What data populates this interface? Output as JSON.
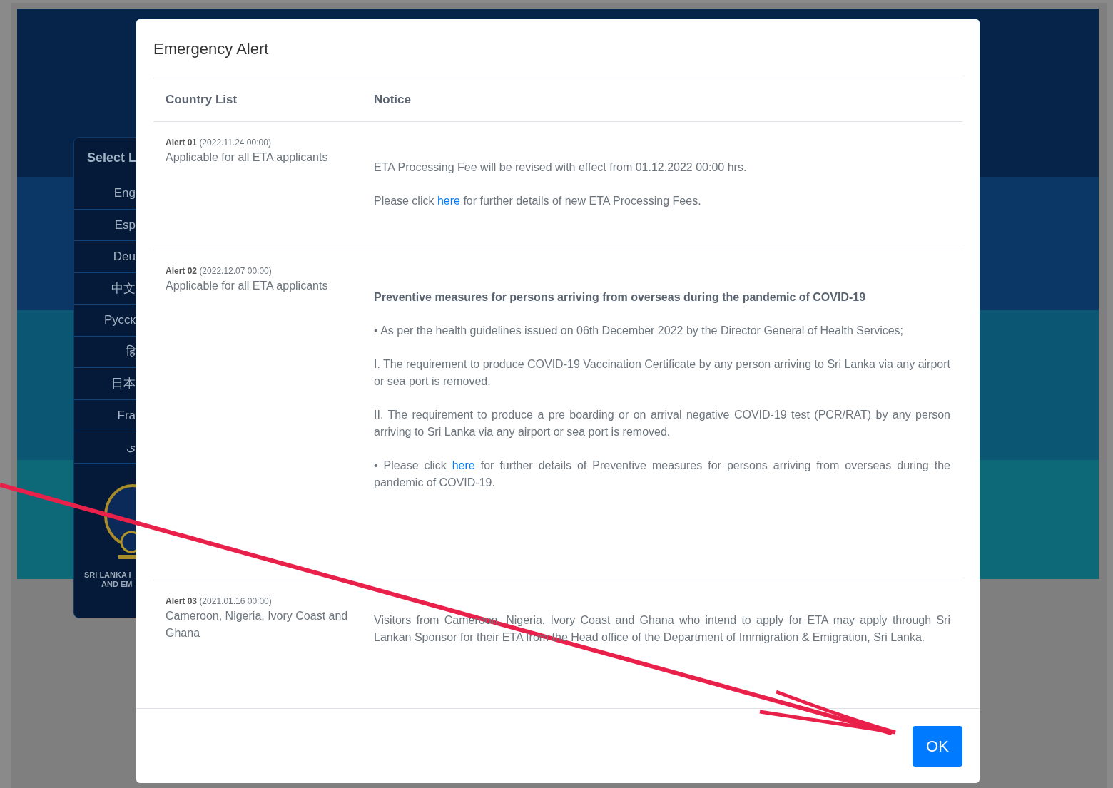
{
  "sidebar": {
    "title": "Select L",
    "languages": [
      "Eng",
      "Esp",
      "Deu",
      "中文",
      "Русск",
      "हि",
      "日本",
      "Fra",
      "ی"
    ],
    "emblem_caption": [
      "SRI LANKA I",
      "AND EM"
    ]
  },
  "window": {
    "title": "Emergency Alert"
  },
  "table": {
    "columns": [
      "Country List",
      "Notice"
    ],
    "rows": [
      {
        "alert": "Alert 01",
        "date": "(2022.11.24 00:00)",
        "applies_to": "Applicable for all ETA applicants",
        "notice": [
          {
            "kind": "text",
            "text": "ETA Processing Fee will be revised with effect from 01.12.2022 00:00 hrs."
          },
          {
            "kind": "link_text",
            "before": "Please click ",
            "link": "here",
            "after": " for further details of new ETA Processing Fees."
          }
        ]
      },
      {
        "alert": "Alert 02",
        "date": "(2022.12.07 00:00)",
        "applies_to": "Applicable for all ETA applicants",
        "notice": [
          {
            "kind": "heading",
            "text": "Preventive measures for persons arriving from overseas during the pandemic of COVID-19"
          },
          {
            "kind": "text",
            "text": "• As per the health guidelines issued on 06th December 2022 by the Director General of Health Services;"
          },
          {
            "kind": "text",
            "text": "I. The requirement to produce COVID-19 Vaccination Certificate by any person arriving to Sri Lanka via any airport or sea port is removed."
          },
          {
            "kind": "text",
            "text": "II. The requirement to produce a pre boarding or on arrival negative COVID-19 test (PCR/RAT) by any person arriving to Sri Lanka via any airport or sea port is removed."
          },
          {
            "kind": "link_text",
            "before": "• Please click ",
            "link": "here",
            "after": " for further details of Preventive measures for persons arriving from overseas during the pandemic of COVID-19."
          }
        ]
      },
      {
        "alert": "Alert 03",
        "date": "(2021.01.16 00:00)",
        "applies_to": "Cameroon, Nigeria, Ivory Coast and Ghana",
        "notice": [
          {
            "kind": "text",
            "text": "Visitors from Cameroon, Nigeria, Ivory Coast and Ghana who intend to apply for ETA may apply through Sri Lankan Sponsor for their ETA from the Head office of the Department of Immigration & Emigration, Sri Lanka."
          }
        ]
      }
    ]
  },
  "buttons": [
    "OK"
  ]
}
